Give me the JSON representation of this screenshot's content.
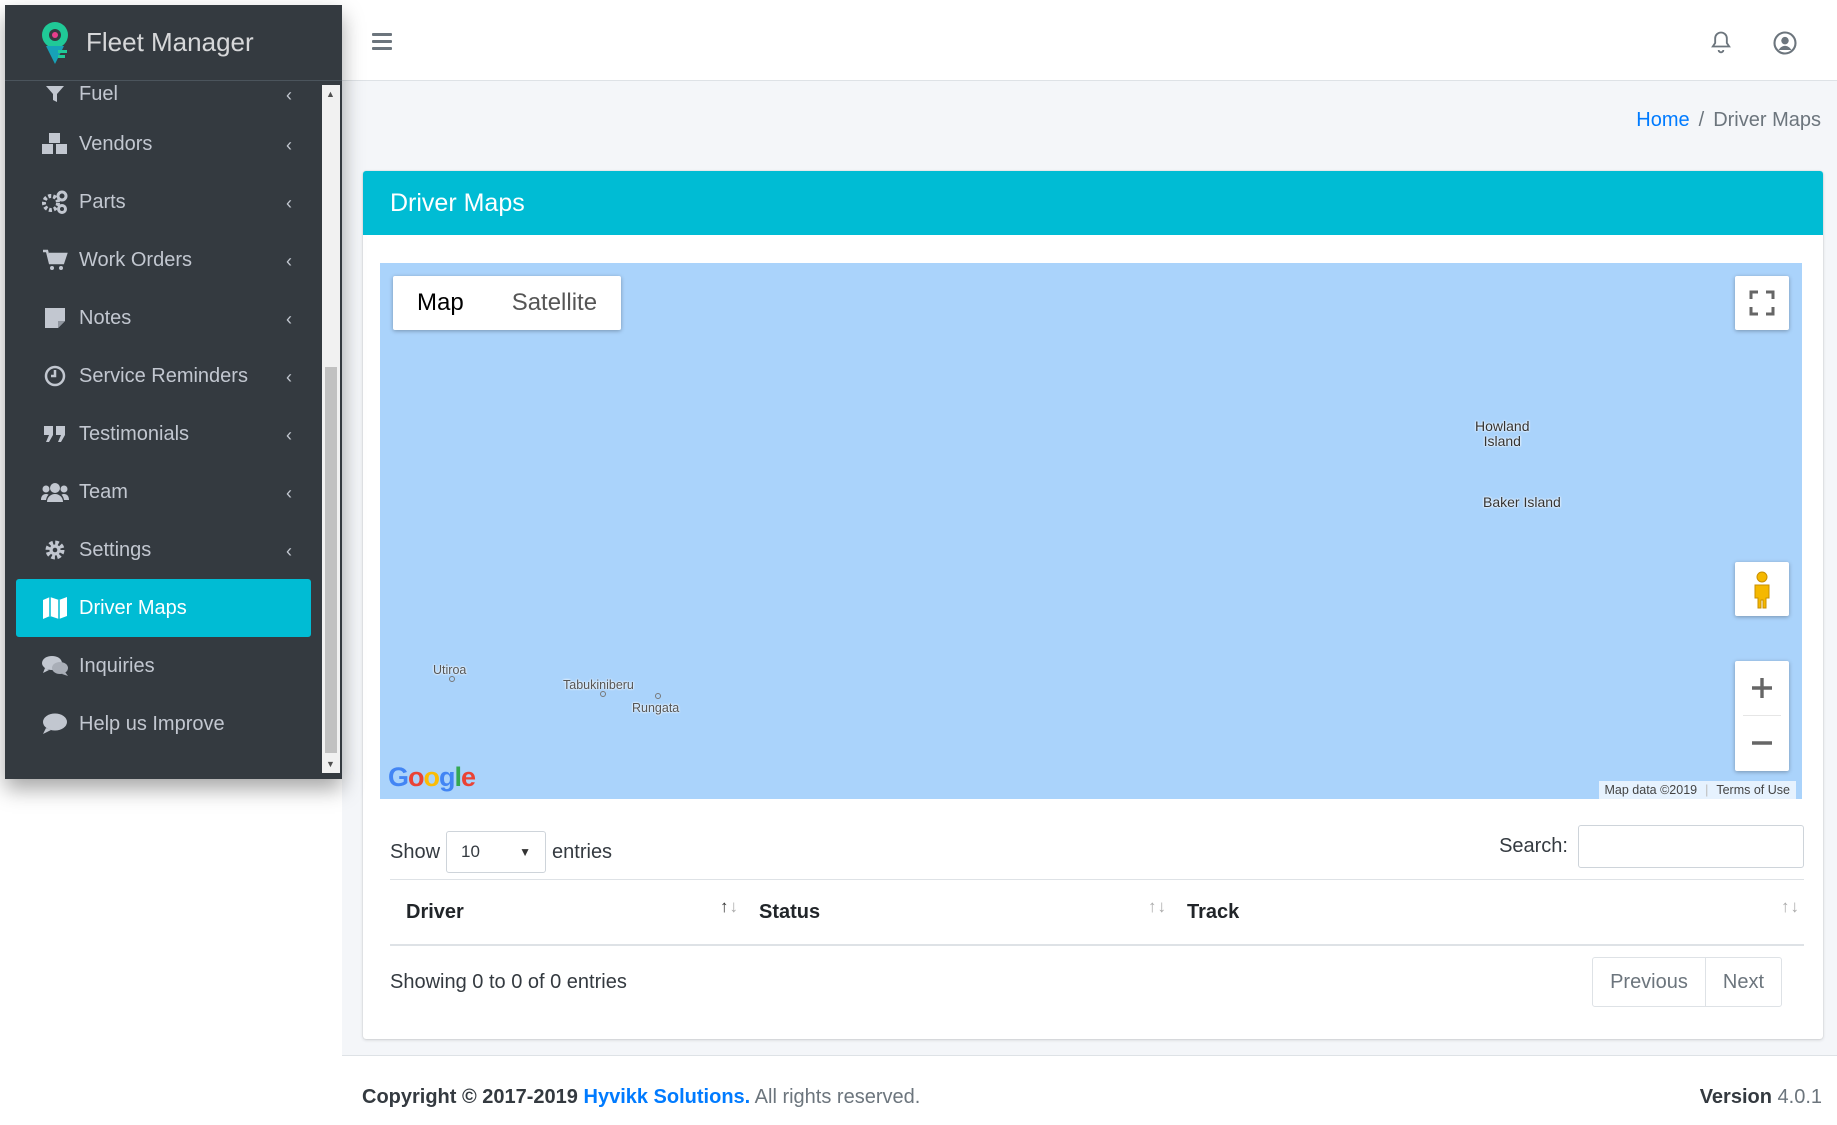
{
  "app": {
    "title": "Fleet Manager"
  },
  "sidebar": {
    "items": [
      {
        "label": "Fuel",
        "icon": "filter-icon"
      },
      {
        "label": "Vendors",
        "icon": "cubes-icon"
      },
      {
        "label": "Parts",
        "icon": "cogs-icon"
      },
      {
        "label": "Work Orders",
        "icon": "cart-icon"
      },
      {
        "label": "Notes",
        "icon": "sticky-note-icon"
      },
      {
        "label": "Service Reminders",
        "icon": "clock-icon"
      },
      {
        "label": "Testimonials",
        "icon": "quote-icon"
      },
      {
        "label": "Team",
        "icon": "users-icon"
      },
      {
        "label": "Settings",
        "icon": "gear-icon"
      },
      {
        "label": "Driver Maps",
        "icon": "map-icon",
        "active": true
      },
      {
        "label": "Inquiries",
        "icon": "comments-icon"
      },
      {
        "label": "Help us Improve",
        "icon": "comment-icon"
      }
    ]
  },
  "breadcrumb": {
    "home": "Home",
    "sep": "/",
    "current": "Driver Maps"
  },
  "card": {
    "title": "Driver Maps"
  },
  "map": {
    "type_map": "Map",
    "type_satellite": "Satellite",
    "labels": {
      "howland": "Howland\nIsland",
      "baker": "Baker Island",
      "utiroa": "Utiroa",
      "tabukiniberu": "Tabukiniberu",
      "rungata": "Rungata"
    },
    "logo": "Google",
    "map_data": "Map data ©2019",
    "terms": "Terms of Use",
    "water_color": "#aad3fb"
  },
  "table": {
    "show_label": "Show",
    "page_size": "10",
    "entries_label": "entries",
    "search_label": "Search:",
    "search_value": "",
    "columns": [
      "Driver",
      "Status",
      "Track"
    ],
    "info": "Showing 0 to 0 of 0 entries",
    "previous": "Previous",
    "next": "Next"
  },
  "footer": {
    "copyright_prefix": "Copyright © 2017-2019",
    "company": "Hyvikk Solutions.",
    "rights": "All rights reserved.",
    "version_label": "Version",
    "version": "4.0.1"
  },
  "colors": {
    "accent": "#00bcd4",
    "sidebar_bg": "#343a40",
    "link": "#007bff"
  }
}
